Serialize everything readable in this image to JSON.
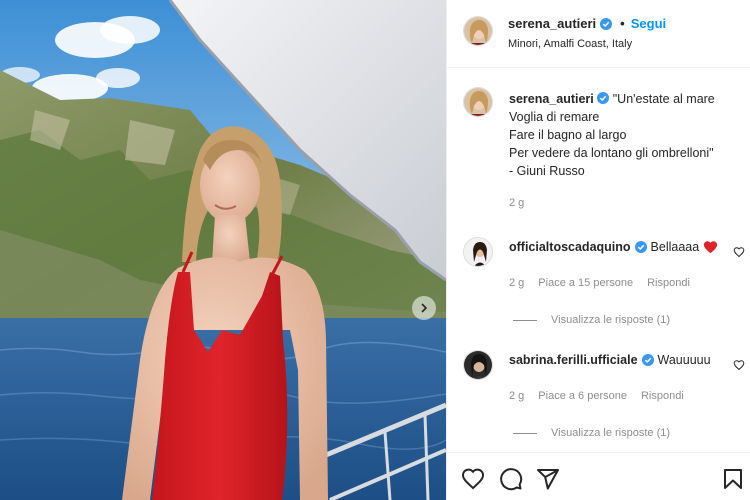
{
  "post": {
    "username": "serena_autieri",
    "follow_label": "Segui",
    "separator": "•",
    "location": "Minori, Amalfi Coast, Italy"
  },
  "caption": {
    "username": "serena_autieri",
    "lines": [
      "\"Un'estate al mare",
      "Voglia di remare",
      "Fare il bagno al largo",
      "Per vedere da lontano gli ombrelloni\"",
      "- Giuni Russo"
    ],
    "time": "2 g"
  },
  "comments": [
    {
      "username": "officialtoscadaquino",
      "text": "Bellaaaa",
      "emoji": "❤️",
      "time": "2 g",
      "likes": "Piace a 15 persone",
      "reply_label": "Rispondi",
      "replies_label": "Visualizza le risposte (1)"
    },
    {
      "username": "sabrina.ferilli.ufficiale",
      "text": "Wauuuuu",
      "time": "2 g",
      "likes": "Piace a 6 persone",
      "reply_label": "Rispondi",
      "replies_label": "Visualizza le risposte (1)"
    }
  ],
  "icons": {
    "verified": "verified-badge-icon",
    "like": "heart-icon",
    "comment": "comment-icon",
    "share": "paper-plane-icon",
    "save": "bookmark-icon",
    "next": "chevron-right-icon"
  },
  "colors": {
    "accent": "#0095f6",
    "verified": "#3897f0",
    "muted": "#8e8e8e",
    "heart_red": "#ed4956"
  }
}
